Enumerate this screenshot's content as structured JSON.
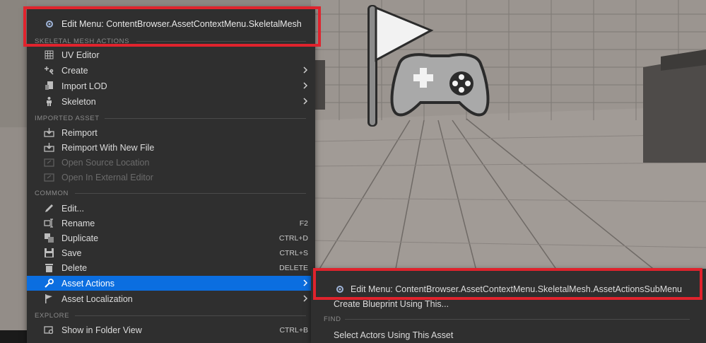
{
  "menu": {
    "edit_menu_label": "Edit Menu: ContentBrowser.AssetContextMenu.SkeletalMesh",
    "sections": [
      {
        "key": "skeletal",
        "header": "SKELETAL MESH ACTIONS"
      },
      {
        "key": "imported",
        "header": "IMPORTED ASSET"
      },
      {
        "key": "common",
        "header": "COMMON"
      },
      {
        "key": "explore",
        "header": "EXPLORE"
      }
    ],
    "items": [
      {
        "label": "UV Editor",
        "icon": "uv-grid-icon",
        "shortcut": "",
        "submenu": false,
        "disabled": false
      },
      {
        "label": "Create",
        "icon": "create-icon",
        "shortcut": "",
        "submenu": true,
        "disabled": false
      },
      {
        "label": "Import LOD",
        "icon": "import-lod-icon",
        "shortcut": "",
        "submenu": true,
        "disabled": false
      },
      {
        "label": "Skeleton",
        "icon": "skeleton-icon",
        "shortcut": "",
        "submenu": true,
        "disabled": false
      },
      {
        "label": "Reimport",
        "icon": "reimport-icon",
        "shortcut": "",
        "submenu": false,
        "disabled": false
      },
      {
        "label": "Reimport With New File",
        "icon": "reimport-icon",
        "shortcut": "",
        "submenu": false,
        "disabled": false
      },
      {
        "label": "Open Source Location",
        "icon": "folder-open-icon",
        "shortcut": "",
        "submenu": false,
        "disabled": true
      },
      {
        "label": "Open In External Editor",
        "icon": "external-editor-icon",
        "shortcut": "",
        "submenu": false,
        "disabled": true
      },
      {
        "label": "Edit...",
        "icon": "pencil-icon",
        "shortcut": "",
        "submenu": false,
        "disabled": false
      },
      {
        "label": "Rename",
        "icon": "rename-icon",
        "shortcut": "F2",
        "submenu": false,
        "disabled": false
      },
      {
        "label": "Duplicate",
        "icon": "duplicate-icon",
        "shortcut": "CTRL+D",
        "submenu": false,
        "disabled": false
      },
      {
        "label": "Save",
        "icon": "save-icon",
        "shortcut": "CTRL+S",
        "submenu": false,
        "disabled": false
      },
      {
        "label": "Delete",
        "icon": "trash-icon",
        "shortcut": "DELETE",
        "submenu": false,
        "disabled": false
      },
      {
        "label": "Asset Actions",
        "icon": "wrench-icon",
        "shortcut": "",
        "submenu": true,
        "disabled": false,
        "selected": true
      },
      {
        "label": "Asset Localization",
        "icon": "flag-icon",
        "shortcut": "",
        "submenu": true,
        "disabled": false
      },
      {
        "label": "Show in Folder View",
        "icon": "folder-search-icon",
        "shortcut": "CTRL+B",
        "submenu": false,
        "disabled": false
      }
    ]
  },
  "submenu": {
    "edit_menu_label": "Edit Menu: ContentBrowser.AssetContextMenu.SkeletalMesh.AssetActionsSubMenu",
    "create_blueprint": "Create Blueprint Using This...",
    "find_header": "FIND",
    "select_actors": "Select Actors Using This Asset"
  },
  "colors": {
    "menu_bg": "#2f2f2f",
    "selection": "#0b6ee0",
    "highlight": "#e0232d"
  }
}
